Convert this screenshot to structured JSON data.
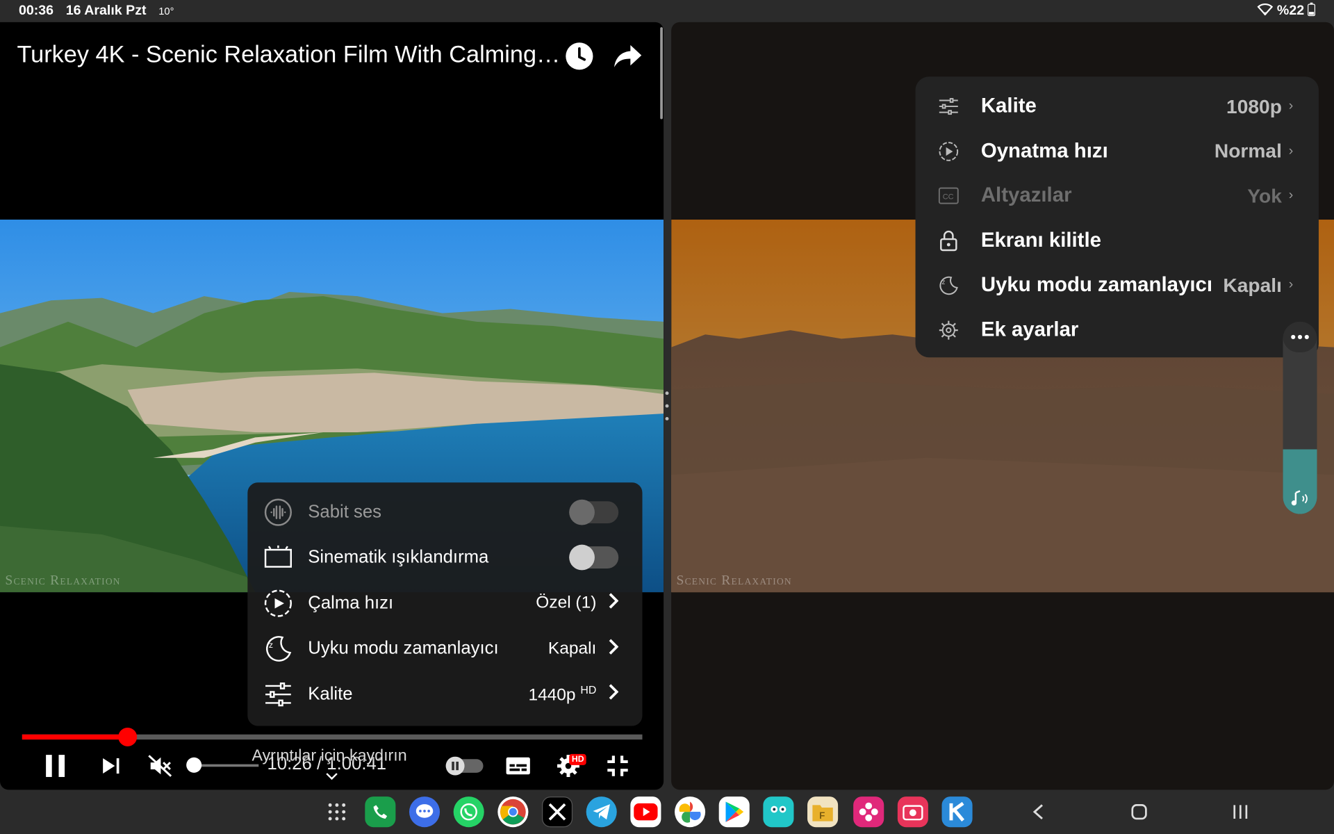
{
  "status_bar": {
    "time": "00:36",
    "date": "16 Aralık Pzt",
    "temperature": "10°",
    "battery": "%22"
  },
  "left_player": {
    "title": "Turkey 4K - Scenic Relaxation Film With Calming Music",
    "watermark": "Scenic Relaxation",
    "settings_menu": {
      "items": [
        {
          "label": "Sabit ses",
          "type": "toggle",
          "on": false,
          "disabled": true,
          "icon": "stable-volume-icon"
        },
        {
          "label": "Sinematik ışıklandırma",
          "type": "toggle",
          "on": false,
          "icon": "ambient-mode-icon"
        },
        {
          "label": "Çalma hızı",
          "value": "Özel (1)",
          "icon": "playback-speed-icon"
        },
        {
          "label": "Uyku modu zamanlayıcı",
          "value": "Kapalı",
          "icon": "sleep-timer-icon"
        },
        {
          "label": "Kalite",
          "value": "1440p",
          "value_badge": "HD",
          "icon": "quality-icon"
        }
      ]
    },
    "progress_fraction": 0.17,
    "volume_fraction": 0.0,
    "time_display": "10:26 / 1:00:41",
    "hint": "Ayrıntılar için kaydırın",
    "hd_badge": "HD"
  },
  "right_player": {
    "watermark": "Scenic Relaxation",
    "menu": {
      "items": [
        {
          "label": "Kalite",
          "value": "1080p",
          "icon": "quality-icon"
        },
        {
          "label": "Oynatma hızı",
          "value": "Normal",
          "icon": "playback-speed-icon"
        },
        {
          "label": "Altyazılar",
          "value": "Yok",
          "disabled": true,
          "icon": "captions-icon"
        },
        {
          "label": "Ekranı kilitle",
          "value": "",
          "icon": "lock-icon"
        },
        {
          "label": "Uyku modu zamanlayıcı",
          "value": "Kapalı",
          "icon": "sleep-timer-icon"
        },
        {
          "label": "Ek ayarlar",
          "value": "",
          "icon": "gear-icon"
        }
      ]
    },
    "volume_level_fraction": 0.4
  },
  "taskbar": {
    "apps": [
      "apps-grid-icon",
      "phone-icon",
      "messages-icon",
      "whatsapp-icon",
      "chrome-icon",
      "x-icon",
      "telegram-icon",
      "youtube-icon",
      "photos-icon",
      "play-store-icon",
      "app-teal-icon",
      "files-icon",
      "gallery-flower-icon",
      "screen-recorder-icon",
      "k-app-icon"
    ],
    "nav": [
      "back-icon",
      "home-icon",
      "recents-icon"
    ]
  }
}
